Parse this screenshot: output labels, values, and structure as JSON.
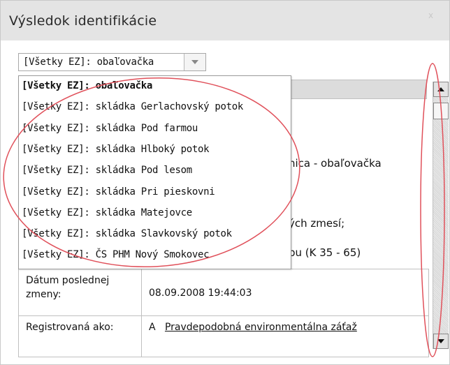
{
  "dialog": {
    "title": "Výsledok identifikácie",
    "close_label": "x"
  },
  "select": {
    "value": "[Všetky EZ]: obaľovačka"
  },
  "dropdown": {
    "options": [
      "[Všetky EZ]: obaľovačka",
      "[Všetky EZ]: skládka Gerlachovský potok",
      "[Všetky EZ]: skládka Pod farmou",
      "[Všetky EZ]: skládka Hlboký potok",
      "[Všetky EZ]: skládka Pod lesom",
      "[Všetky EZ]: skládka Pri pieskovni",
      "[Všetky EZ]: skládka Matejovce",
      "[Všetky EZ]: skládka Slavkovský potok",
      "[Všetky EZ]: ČS PHM Nový Smokovec"
    ],
    "selected_index": 0
  },
  "background": {
    "fragment_1": "nica - obaľovačka",
    "fragment_2": "ých zmesí;",
    "fragment_3": "pu (K 35 - 65)"
  },
  "details": {
    "last_change_label": "Dátum poslednej zmeny:",
    "last_change_value": "08.09.2008 19:44:03",
    "registered_label": "Registrovaná ako:",
    "registered_code": "A",
    "registered_value": "Pravdepodobná environmentálna záťaž"
  },
  "colors": {
    "annotation": "#e0505a",
    "titlebar": "#e4e4e4"
  }
}
